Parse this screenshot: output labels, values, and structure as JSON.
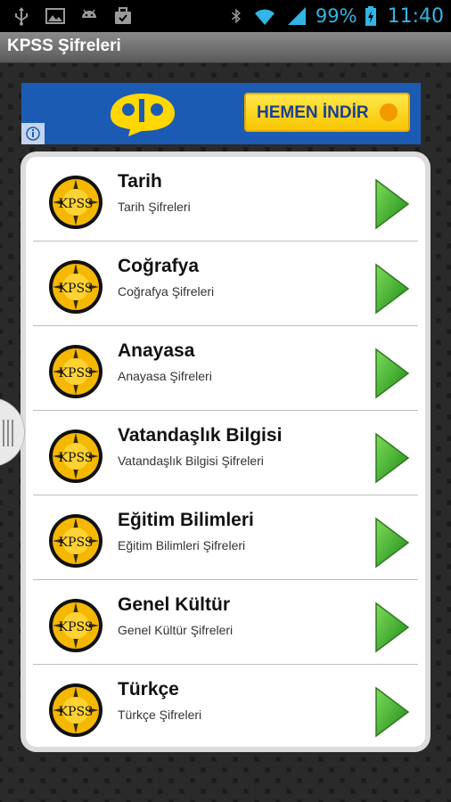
{
  "status_bar": {
    "battery_percent": "99%",
    "time": "11:40",
    "accent_color": "#33b5e5",
    "left_icons": [
      "usb-icon",
      "image-icon",
      "android-icon",
      "briefcase-icon"
    ],
    "right_icons": [
      "bluetooth-icon",
      "wifi-icon",
      "signal-icon",
      "battery-charging-icon"
    ]
  },
  "app_bar": {
    "title": "KPSS Şifreleri"
  },
  "ad": {
    "button_label": "HEMEN İNDİR",
    "brand_color": "#1c5bb4",
    "button_color": "#f8c600"
  },
  "list": {
    "items": [
      {
        "title": "Tarih",
        "subtitle": "Tarih Şifreleri",
        "icon_text": "KPSS"
      },
      {
        "title": "Coğrafya",
        "subtitle": "Coğrafya Şifreleri",
        "icon_text": "KPSS"
      },
      {
        "title": "Anayasa",
        "subtitle": "Anayasa Şifreleri",
        "icon_text": "KPSS"
      },
      {
        "title": "Vatandaşlık Bilgisi",
        "subtitle": "Vatandaşlık Bilgisi Şifreleri",
        "icon_text": "KPSS"
      },
      {
        "title": "Eğitim Bilimleri",
        "subtitle": "Eğitim Bilimleri Şifreleri",
        "icon_text": "KPSS"
      },
      {
        "title": "Genel Kültür",
        "subtitle": "Genel Kültür Şifreleri",
        "icon_text": "KPSS"
      },
      {
        "title": "Türkçe",
        "subtitle": "Türkçe Şifreleri",
        "icon_text": "KPSS"
      }
    ]
  }
}
